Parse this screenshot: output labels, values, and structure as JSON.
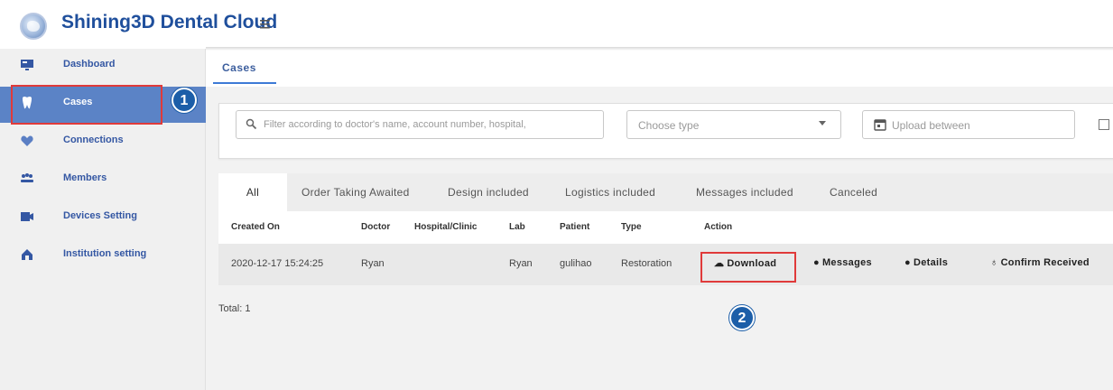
{
  "header": {
    "title": "Shining3D Dental Cloud",
    "menu_icon": "hamburger-icon"
  },
  "sidebar": {
    "items": [
      {
        "label": "Dashboard",
        "icon": "monitor-icon"
      },
      {
        "label": "Cases",
        "icon": "tooth-icon",
        "active": true
      },
      {
        "label": "Connections",
        "icon": "heart-icon"
      },
      {
        "label": "Members",
        "icon": "group-icon"
      },
      {
        "label": "Devices Setting",
        "icon": "device-icon"
      },
      {
        "label": "Institution setting",
        "icon": "building-icon"
      }
    ]
  },
  "annotations": {
    "step1": "1",
    "step2": "2",
    "highlight_color": "#e03a3a",
    "badge_color": "#1c5ea8"
  },
  "main": {
    "tab": "Cases",
    "filters": {
      "search_placeholder": "Filter according to doctor's name, account number, hospital,",
      "type_placeholder": "Choose type",
      "date_placeholder": "Upload between"
    },
    "subtabs": [
      "All",
      "Order Taking Awaited",
      "Design included",
      "Logistics included",
      "Messages included",
      "Canceled"
    ],
    "table": {
      "headers": [
        "Created On",
        "Doctor",
        "Hospital/Clinic",
        "Lab",
        "Patient",
        "Type",
        "Action"
      ],
      "rows": [
        {
          "created_on": "2020-12-17 15:24:25",
          "doctor": "Ryan",
          "hospital": "",
          "lab": "Ryan",
          "patient": "gulihao",
          "type": "Restoration",
          "actions": [
            "Download",
            "Messages",
            "Details",
            "Confirm Received"
          ]
        }
      ]
    },
    "total": "Total: 1"
  }
}
